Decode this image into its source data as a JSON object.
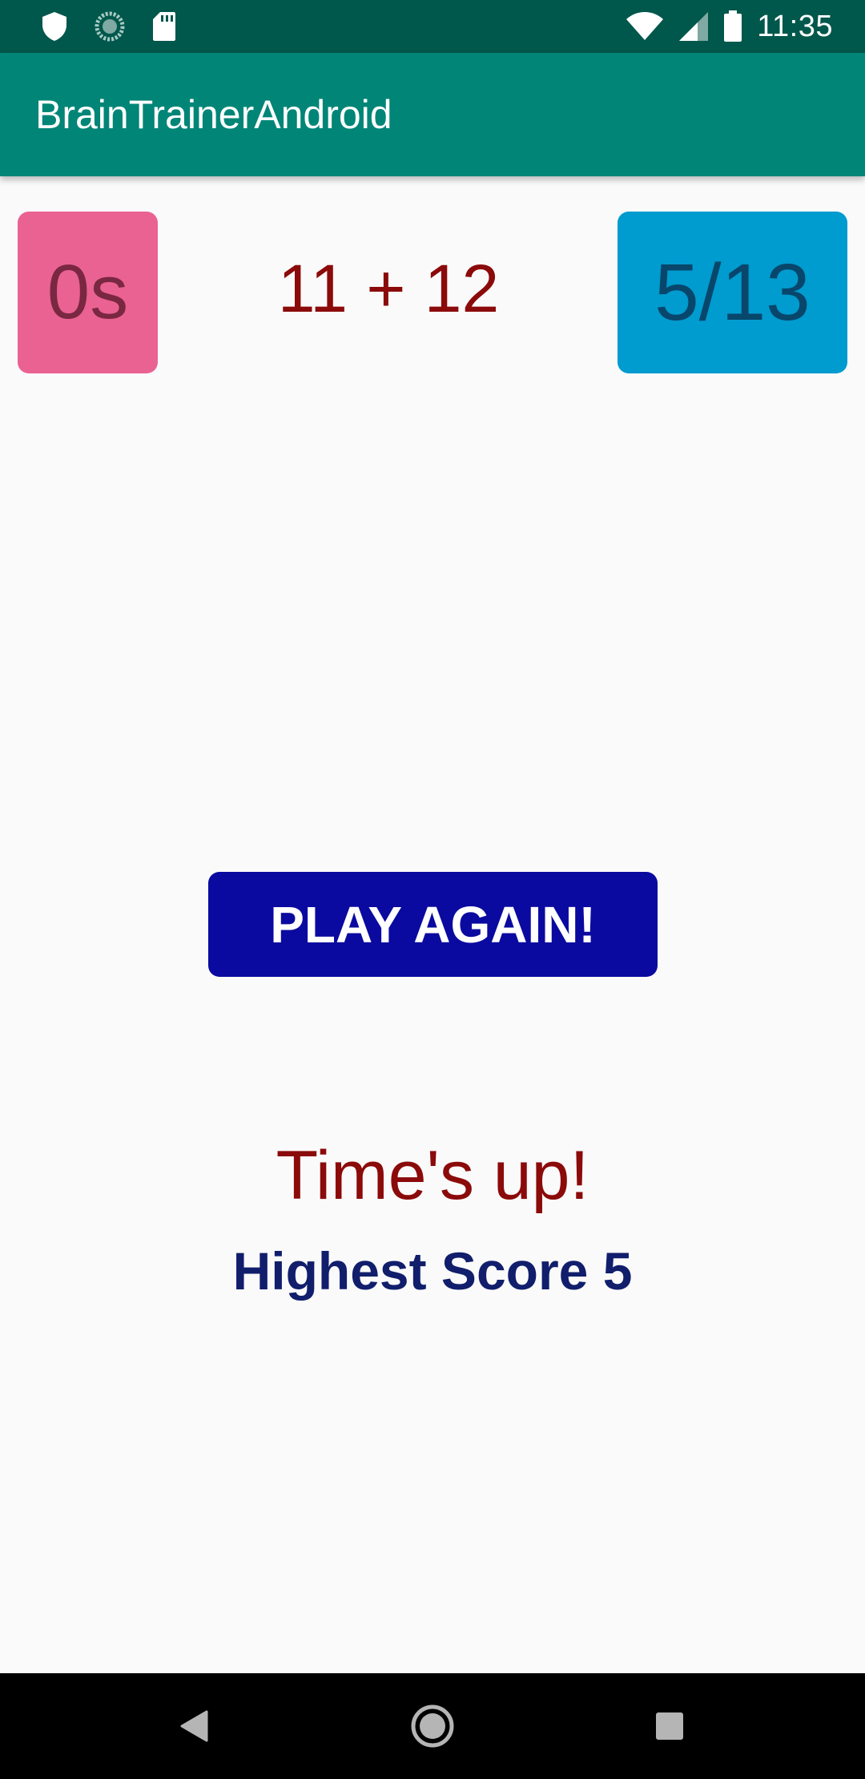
{
  "status_bar": {
    "time": "11:35",
    "left_icons": [
      "shield-icon",
      "loading-circle-icon",
      "sd-card-icon"
    ],
    "right_icons": [
      "wifi-icon",
      "cell-signal-icon",
      "battery-icon"
    ]
  },
  "app_bar": {
    "title": "BrainTrainerAndroid"
  },
  "game": {
    "timer": "0s",
    "question": "11 + 12",
    "score": "5/13",
    "play_again_label": "PLAY AGAIN!",
    "result": "Time's up!",
    "highest_score": "Highest Score 5"
  },
  "colors": {
    "status_bar": "#00574b",
    "app_bar": "#008577",
    "timer_bg": "#e96292",
    "score_bg": "#009bcf",
    "play_again_bg": "#0a0aa0",
    "result_text": "#8b0a0a",
    "highest_text": "#111e6c"
  },
  "nav_bar": {
    "buttons": [
      "back-icon",
      "home-icon",
      "recents-icon"
    ]
  }
}
